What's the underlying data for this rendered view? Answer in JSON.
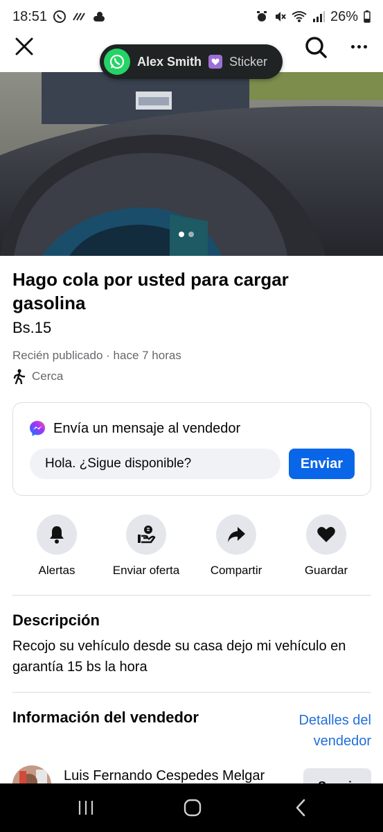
{
  "status_bar": {
    "time": "18:51",
    "battery": "26%"
  },
  "toast": {
    "name": "Alex Smith",
    "subtitle": "Sticker"
  },
  "listing": {
    "title": "Hago cola por usted para cargar gasolina",
    "price": "Bs.15",
    "meta": "Recién publicado · hace 7 horas",
    "location": "Cerca",
    "photo_count": 2,
    "photo_index": 1
  },
  "message": {
    "header": "Envía un mensaje al vendedor",
    "input_value": "Hola. ¿Sigue disponible?",
    "send_label": "Enviar"
  },
  "actions": [
    {
      "label": "Alertas",
      "icon": "bell-icon"
    },
    {
      "label": "Enviar oferta",
      "icon": "offer-icon"
    },
    {
      "label": "Compartir",
      "icon": "share-icon"
    },
    {
      "label": "Guardar",
      "icon": "heart-icon"
    }
  ],
  "description": {
    "title": "Descripción",
    "text": "Recojo su vehículo desde su casa dejo mi vehículo en garantía 15 bs la hora"
  },
  "seller": {
    "title": "Información del vendedor",
    "details_link": "Detalles del vendedor",
    "name": "Luis Fernando Cespedes Melgar",
    "follow_label": "Seguir"
  },
  "colors": {
    "accent": "#0a66e8",
    "link": "#216fdb",
    "whatsapp": "#25d366"
  }
}
